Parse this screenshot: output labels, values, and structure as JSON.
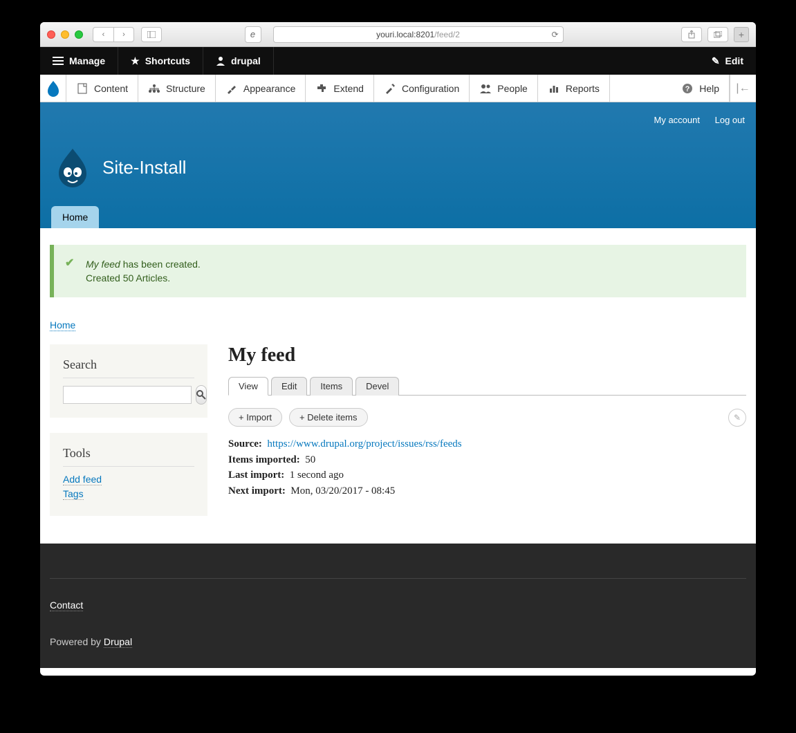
{
  "browser": {
    "url_prefix": "youri.local:8201",
    "url_path": "/feed/2"
  },
  "toolbar": {
    "manage": "Manage",
    "shortcuts": "Shortcuts",
    "user": "drupal",
    "edit": "Edit"
  },
  "admin_menu": {
    "content": "Content",
    "structure": "Structure",
    "appearance": "Appearance",
    "extend": "Extend",
    "configuration": "Configuration",
    "people": "People",
    "reports": "Reports",
    "help": "Help"
  },
  "header": {
    "my_account": "My account",
    "log_out": "Log out",
    "site_name": "Site-Install",
    "home_tab": "Home"
  },
  "messages": {
    "line1_em": "My feed",
    "line1_rest": " has been created.",
    "line2": "Created 50 Articles."
  },
  "breadcrumb": {
    "home": "Home"
  },
  "sidebar": {
    "search_title": "Search",
    "tools_title": "Tools",
    "add_feed": "Add feed",
    "tags": "Tags"
  },
  "main": {
    "title": "My feed",
    "tabs": {
      "view": "View",
      "edit": "Edit",
      "items": "Items",
      "devel": "Devel"
    },
    "actions": {
      "import": "+ Import",
      "delete": "+ Delete items"
    },
    "details": {
      "source_label": "Source:",
      "source_url": "https://www.drupal.org/project/issues/rss/feeds",
      "items_label": "Items imported:",
      "items_value": "50",
      "last_label": "Last import:",
      "last_value": "1 second ago",
      "next_label": "Next import:",
      "next_value": "Mon, 03/20/2017 - 08:45"
    }
  },
  "footer": {
    "contact": "Contact",
    "powered_prefix": "Powered by ",
    "powered_link": "Drupal"
  }
}
